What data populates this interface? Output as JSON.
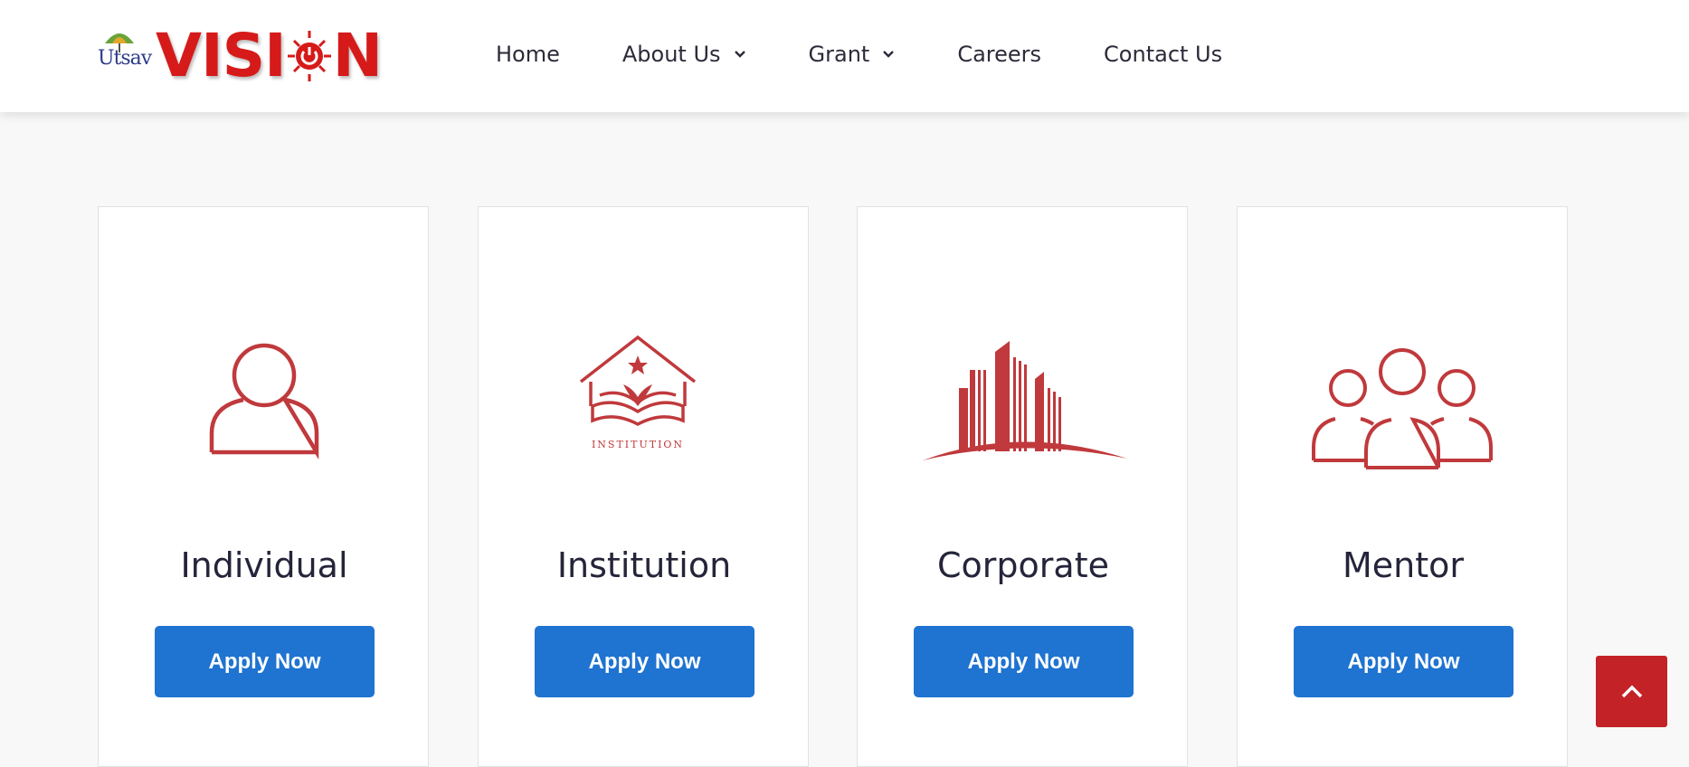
{
  "logo": {
    "small_text": "Utsav",
    "brand": "VISION",
    "brand_before": "VISI",
    "brand_after": "N"
  },
  "nav": {
    "items": [
      {
        "label": "Home",
        "dropdown": false
      },
      {
        "label": "About Us",
        "dropdown": true
      },
      {
        "label": "Grant",
        "dropdown": true
      },
      {
        "label": "Careers",
        "dropdown": false
      },
      {
        "label": "Contact Us",
        "dropdown": false
      }
    ]
  },
  "cards": [
    {
      "title": "Individual",
      "button": "Apply Now",
      "icon": "person-icon"
    },
    {
      "title": "Institution",
      "button": "Apply Now",
      "icon": "institution-icon",
      "icon_text": "INSTITUTION"
    },
    {
      "title": "Corporate",
      "button": "Apply Now",
      "icon": "buildings-icon"
    },
    {
      "title": "Mentor",
      "button": "Apply Now",
      "icon": "group-icon"
    }
  ],
  "colors": {
    "accent_red": "#c32227",
    "button_blue": "#1f73d1",
    "brand_red": "#d61a1a"
  },
  "scroll_top": {
    "icon": "chevron-up-icon"
  }
}
